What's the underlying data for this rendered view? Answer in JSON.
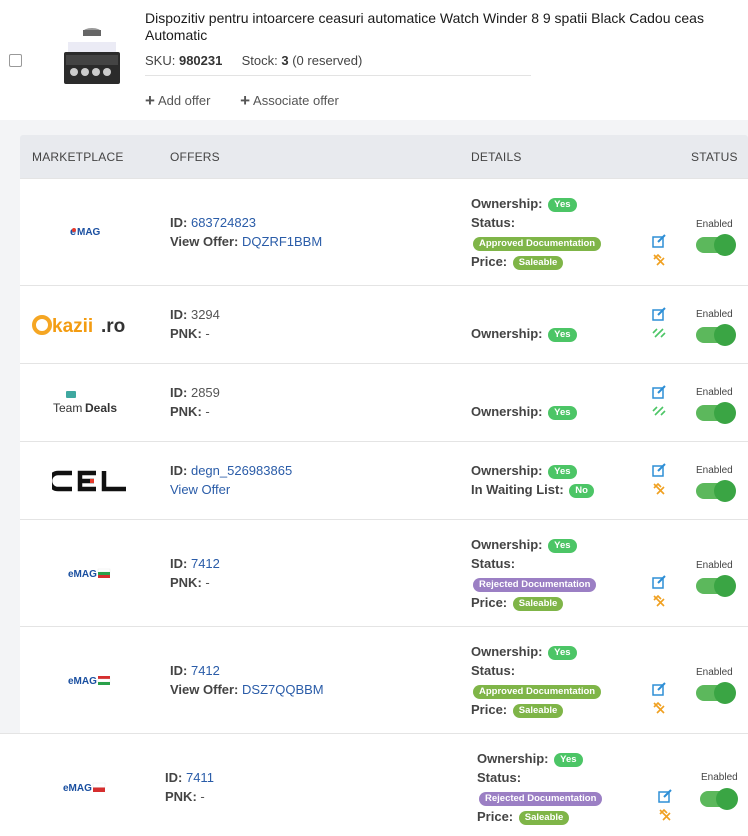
{
  "product": {
    "title": "Dispozitiv pentru intoarcere ceasuri automatice Watch Winder 8 9 spatii Black Cadou ceas Automatic",
    "sku_label": "SKU:",
    "sku_value": "980231",
    "stock_label": "Stock:",
    "stock_value": "3",
    "reserved_text": "(0 reserved)",
    "add_offer_label": "Add offer",
    "associate_offer_label": "Associate offer"
  },
  "table": {
    "headers": {
      "marketplace": "MARKETPLACE",
      "offers": "OFFERS",
      "details": "DETAILS",
      "status": "STATUS"
    }
  },
  "labels": {
    "id": "ID:",
    "view_offer": "View Offer:",
    "pnk": "PNK:",
    "ownership": "Ownership:",
    "status": "Status:",
    "price": "Price:",
    "waiting_list": "In Waiting List:",
    "enabled": "Enabled",
    "yes": "Yes",
    "no": "No",
    "approved": "Approved Documentation",
    "rejected": "Rejected Documentation",
    "saleable": "Saleable",
    "view_offer_link": "View Offer"
  },
  "rows": [
    {
      "marketplace": "eMAG",
      "id": "683724823",
      "view_offer": "DQZRF1BBM"
    },
    {
      "marketplace": "Okazii.ro",
      "id": "3294",
      "pnk": "-"
    },
    {
      "marketplace": "TeamDeals",
      "id": "2859",
      "pnk": "-"
    },
    {
      "marketplace": "CEL",
      "id": "degn_526983865"
    },
    {
      "marketplace": "eMAG BG",
      "id": "7412",
      "pnk": "-"
    },
    {
      "marketplace": "eMAG HU",
      "id": "7412",
      "view_offer": "DSZ7QQBBM"
    },
    {
      "marketplace": "eMAG PL",
      "id": "7411",
      "pnk": "-"
    }
  ],
  "colors": {
    "accent_blue": "#2a5ca8",
    "toggle_green": "#3aa544",
    "edit_icon": "#2e8fd6",
    "unlink_icon": "#f0a020",
    "link_icon": "#4cc566"
  },
  "icons": {
    "edit": "edit-icon",
    "unlink": "unlink-icon",
    "link": "link-icon"
  }
}
